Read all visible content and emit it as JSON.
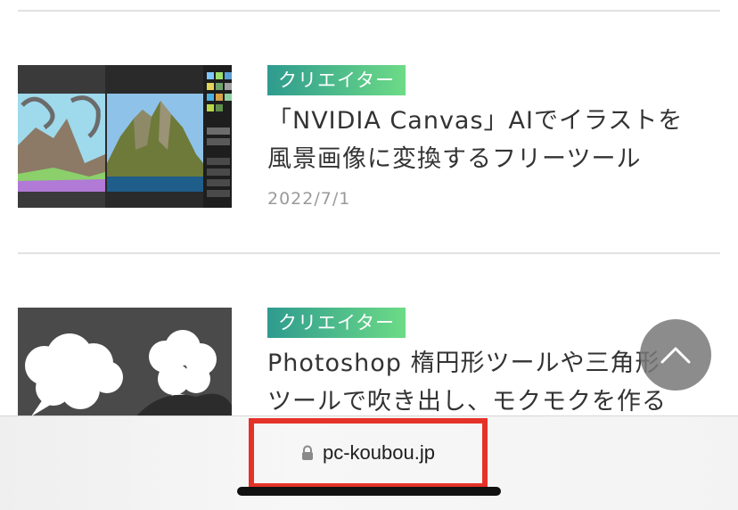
{
  "articles": [
    {
      "category": "クリエイター",
      "title_line1": "「NVIDIA Canvas」AIでイラストを",
      "title_line2": "風景画像に変換するフリーツール",
      "date": "2022/7/1"
    },
    {
      "category": "クリエイター",
      "title_line1": "Photoshop 楕円形ツールや三角形",
      "title_line2": "ツールで吹き出し、モクモクを作る"
    }
  ],
  "browser": {
    "url": "pc-koubou.jp",
    "lock_icon": "lock-icon"
  },
  "colors": {
    "badge_gradient_start": "#2e9b8f",
    "badge_gradient_end": "#6ddb86",
    "highlight_border": "#e53228"
  },
  "scroll_top_icon": "chevron-up-icon"
}
